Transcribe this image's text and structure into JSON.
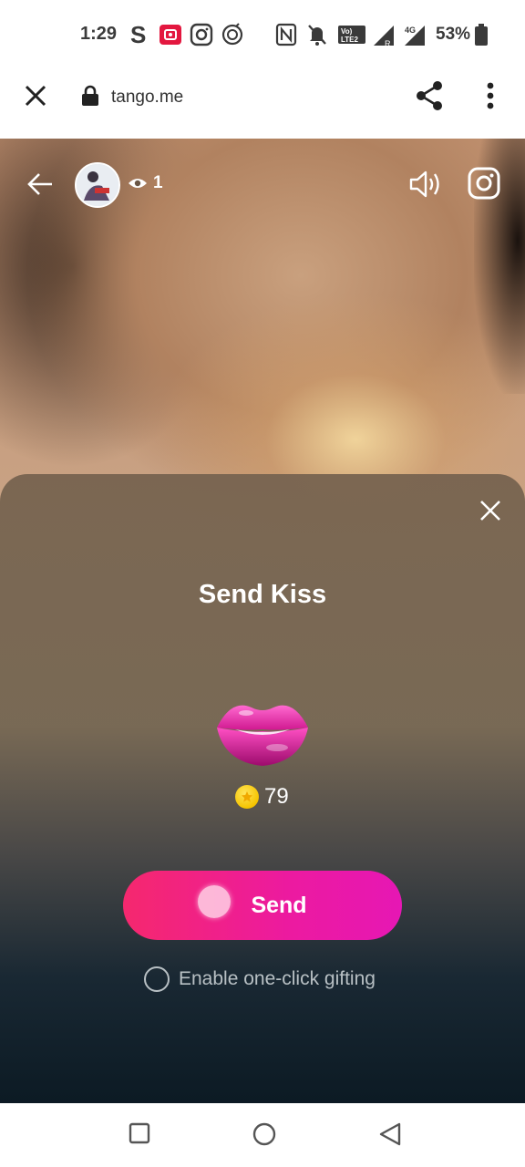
{
  "status_bar": {
    "time": "1:29",
    "battery": "53%",
    "icons": [
      "s-app-icon",
      "youtube-studio-icon",
      "instagram-icon",
      "music-icon",
      "nfc-icon",
      "mute-icon",
      "volte-icon",
      "signal-icon",
      "battery-icon"
    ]
  },
  "browser": {
    "url": "tango.me",
    "icons": [
      "close-icon",
      "lock-icon",
      "share-icon",
      "more-vert-icon"
    ]
  },
  "stream": {
    "viewer_count": "1",
    "icons": [
      "back-arrow-icon",
      "avatar",
      "eye-icon",
      "volume-icon",
      "instagram-icon"
    ]
  },
  "gift_sheet": {
    "title": "Send Kiss",
    "gift_icon": "lips-icon",
    "price": "79",
    "send_label": "Send",
    "one_click_label": "Enable one-click gifting",
    "accent": "#ec1aa0"
  },
  "nav": {
    "icons": [
      "recents-square-icon",
      "home-circle-icon",
      "back-triangle-icon"
    ]
  }
}
